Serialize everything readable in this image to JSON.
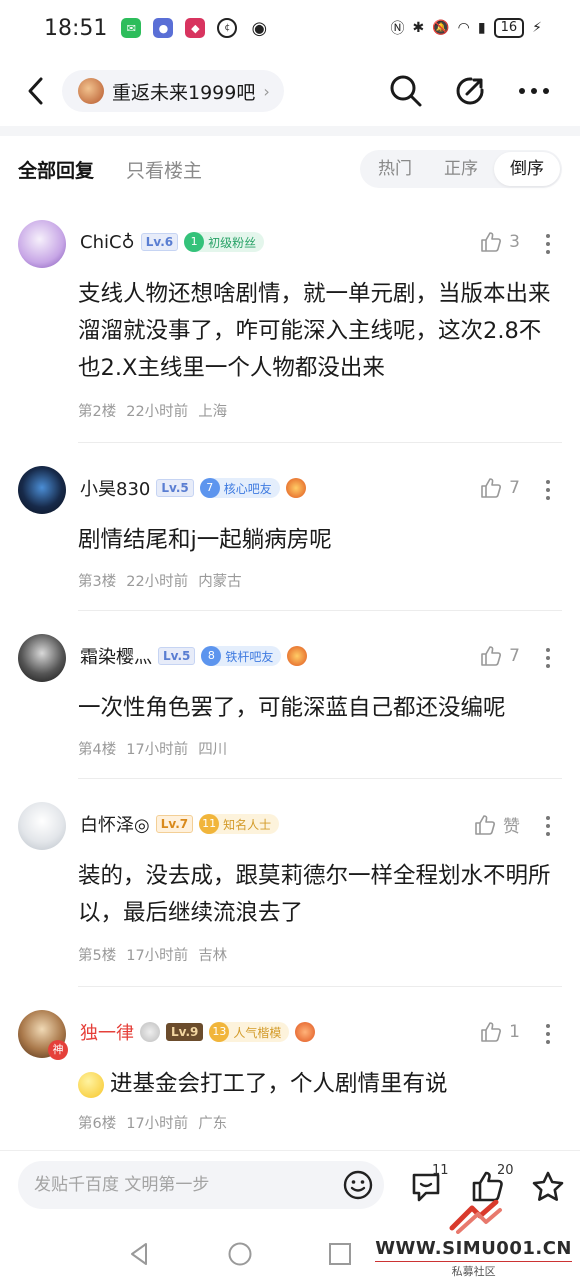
{
  "status_bar": {
    "time": "18:51",
    "battery": "16"
  },
  "header": {
    "forum_name": "重返未来1999吧"
  },
  "sort": {
    "tabs": [
      "全部回复",
      "只看楼主"
    ],
    "order_options": [
      "热门",
      "正序",
      "倒序"
    ],
    "selected_order": "倒序"
  },
  "comments": [
    {
      "username": "ChiC♁",
      "level": "Lv.6",
      "badge_num": "1",
      "badge_label": "初级粉丝",
      "likes": "3",
      "text": "支线人物还想啥剧情，就一单元剧，当版本出来溜溜就没事了，咋可能深入主线呢，这次2.8不也2.X主线里一个人物都没出来",
      "floor": "第2楼",
      "time": "22小时前",
      "location": "上海"
    },
    {
      "username": "小昊830",
      "level": "Lv.5",
      "badge_num": "7",
      "badge_label": "核心吧友",
      "likes": "7",
      "text": "剧情结尾和j一起躺病房呢",
      "floor": "第3楼",
      "time": "22小时前",
      "location": "内蒙古"
    },
    {
      "username": "霜染樱灬",
      "level": "Lv.5",
      "badge_num": "8",
      "badge_label": "铁杆吧友",
      "likes": "7",
      "text": "一次性角色罢了，可能深蓝自己都还没编呢",
      "floor": "第4楼",
      "time": "17小时前",
      "location": "四川"
    },
    {
      "username": "白怀泽◎",
      "level": "Lv.7",
      "badge_num": "11",
      "badge_label": "知名人士",
      "likes": "赞",
      "text": "装的，没去成，跟莫莉德尔一样全程划水不明所以，最后继续流浪去了",
      "floor": "第5楼",
      "time": "17小时前",
      "location": "吉林"
    },
    {
      "username": "独一律",
      "level": "Lv.9",
      "badge_num": "13",
      "badge_label": "人气楷模",
      "likes": "1",
      "text": "进基金会打工了，个人剧情里有说",
      "floor": "第6楼",
      "time": "17小时前",
      "location": "广东",
      "avatar_tag": "神"
    }
  ],
  "bottom_bar": {
    "input_placeholder": "发贴千百度 文明第一步",
    "comment_count": "11",
    "like_count": "20"
  },
  "watermark": {
    "text": "WWW.SIMU001.CN",
    "sub": "私募社区"
  },
  "colors": {
    "accent_blue": "#5d95ee",
    "name_red": "#e5403a",
    "muted": "#9a9a9a"
  }
}
